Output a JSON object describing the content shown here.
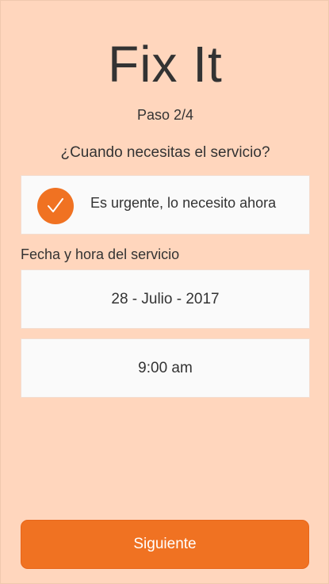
{
  "app": {
    "title": "Fix It"
  },
  "progress": {
    "step_label": "Paso 2/4",
    "current_step": 2,
    "total_steps": 4
  },
  "question": "¿Cuando necesitas el servicio?",
  "urgent_option": {
    "label": "Es urgente, lo necesito ahora",
    "checked": true,
    "icon": "checkmark-icon"
  },
  "schedule": {
    "label": "Fecha y hora del servicio",
    "date_value": "28 - Julio - 2017",
    "time_value": "9:00 am"
  },
  "footer": {
    "next_label": "Siguiente"
  },
  "colors": {
    "background": "#ffd6bd",
    "accent": "#f07222",
    "card": "#fafafa",
    "text": "#333333"
  }
}
